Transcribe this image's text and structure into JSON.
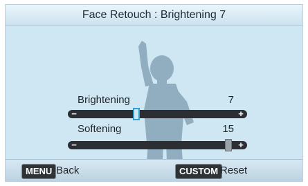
{
  "title": "Face Retouch : Brightening 7",
  "brightening": {
    "label": "Brightening",
    "value": "7",
    "minus": "−",
    "plus": "+",
    "level": 0.35
  },
  "softening": {
    "label": "Softening",
    "value": "15",
    "minus": "−",
    "plus": "+",
    "level": 1.0
  },
  "footer": {
    "menu_key": "MENU",
    "back_label": "Back",
    "custom_key": "CUSTOM",
    "reset_label": "Reset"
  },
  "colors": {
    "background": "#cfe6f3",
    "track": "#2b2f33",
    "handle_active": "#2b9fd6",
    "handle_inactive": "#9aa3a8"
  }
}
